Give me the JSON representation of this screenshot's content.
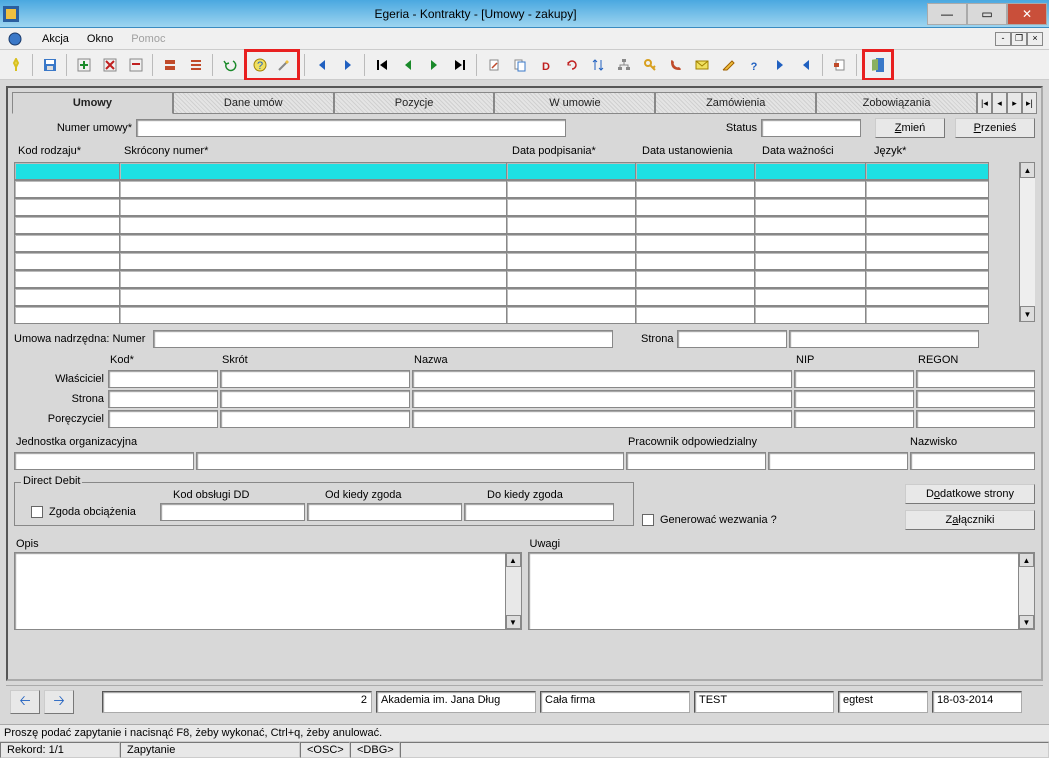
{
  "window": {
    "title": "Egeria - Kontrakty - [Umowy - zakupy]"
  },
  "menu": {
    "akcja": "Akcja",
    "okno": "Okno",
    "pomoc": "Pomoc"
  },
  "tabs": {
    "items": [
      {
        "label": "Umowy",
        "active": true
      },
      {
        "label": "Dane umów",
        "active": false
      },
      {
        "label": "Pozycje",
        "active": false
      },
      {
        "label": "W umowie",
        "active": false
      },
      {
        "label": "Zamówienia",
        "active": false
      },
      {
        "label": "Zobowiązania",
        "active": false
      }
    ]
  },
  "header": {
    "numer_umowy_label": "Numer umowy*",
    "status_label": "Status",
    "zmien_btn": "Zmień",
    "przenies_btn": "Przenieś"
  },
  "grid_headers": {
    "kod": "Kod rodzaju*",
    "skrocony": "Skrócony numer*",
    "data_podp": "Data podpisania*",
    "data_ust": "Data ustanowienia",
    "data_wazn": "Data ważności",
    "jezyk": "Język*"
  },
  "parent": {
    "label": "Umowa nadrzędna: Numer",
    "strona_label": "Strona",
    "kod": "Kod*",
    "skrot": "Skrót",
    "nazwa": "Nazwa",
    "nip": "NIP",
    "regon": "REGON",
    "wlasciciel": "Właściciel",
    "strona": "Strona",
    "poreczyciel": "Poręczyciel"
  },
  "org": {
    "jednostka_label": "Jednostka organizacyjna",
    "pracownik_label": "Pracownik odpowiedzialny",
    "nazwisko_label": "Nazwisko"
  },
  "dd": {
    "legend": "Direct Debit",
    "zgoda_label": "Zgoda obciążenia",
    "kod_label": "Kod obsługi DD",
    "od_label": "Od kiedy zgoda",
    "do_label": "Do kiedy zgoda",
    "generowac_label": "Generować wezwania ?",
    "dodatkowe_btn": "Dodatkowe strony",
    "zalaczniki_btn": "Załączniki"
  },
  "textareas": {
    "opis": "Opis",
    "uwagi": "Uwagi"
  },
  "bottom": {
    "val_num": "2",
    "val_akademia": "Akademia im. Jana Dług",
    "val_firma": "Cała firma",
    "val_test": "TEST",
    "val_user": "egtest",
    "val_date": "18-03-2014"
  },
  "status": {
    "msg": "Proszę podać zapytanie i nacisnąć F8, żeby wykonać, Ctrl+q, żeby anulować.",
    "rekord": "Rekord: 1/1",
    "zapytanie": "Zapytanie",
    "osc": "<OSC>",
    "dbg": "<DBG>"
  }
}
